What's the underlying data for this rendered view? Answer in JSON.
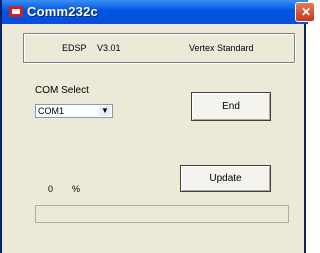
{
  "window": {
    "title": "Comm232c"
  },
  "info": {
    "product": "EDSP",
    "version": "V3.01",
    "vendor": "Vertex Standard"
  },
  "com_select": {
    "label": "COM Select",
    "value": "COM1"
  },
  "buttons": {
    "end": "End",
    "update": "Update"
  },
  "progress": {
    "percent": "0",
    "percent_sign": "%",
    "fraction": 0
  }
}
